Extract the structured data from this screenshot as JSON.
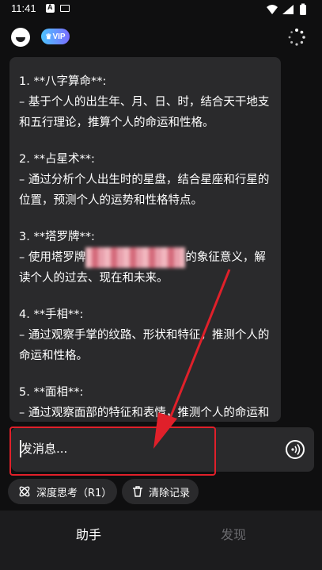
{
  "status_bar": {
    "time": "11:41",
    "notif_letter": "A"
  },
  "header": {
    "vip_label": "VIP"
  },
  "chat": {
    "items": [
      {
        "title": "1. **八字算命**:",
        "body": "  – 基于个人的出生年、月、日、时，结合天干地支和五行理论，推算个人的命运和性格。"
      },
      {
        "title": "2. **占星术**:",
        "body": "  – 通过分析个人出生时的星盘，结合星座和行星的位置，预测个人的运势和性格特点。"
      },
      {
        "title": "3. **塔罗牌**:",
        "body_a": "  – 使用塔罗牌",
        "body_b": "的象征意义，解读个人的过去、现在和未来。"
      },
      {
        "title": "4. **手相**:",
        "body": "  – 通过观察手掌的纹路、形状和特征，推测个人的命运和性格。"
      },
      {
        "title": "5. **面相**:",
        "body": "  – 通过观察面部的特征和表情，推测个人的命运和性格。"
      }
    ]
  },
  "input": {
    "placeholder": "发消息..."
  },
  "actions": {
    "deep_think": "深度思考（R1）",
    "clear_records": "清除记录"
  },
  "nav": {
    "assistant": "助手",
    "discover": "发现"
  },
  "colors": {
    "background": "#0f0f10",
    "bubble": "#2a2a2c",
    "highlight": "#e0202a",
    "nav_inactive": "#6a6a6e"
  }
}
